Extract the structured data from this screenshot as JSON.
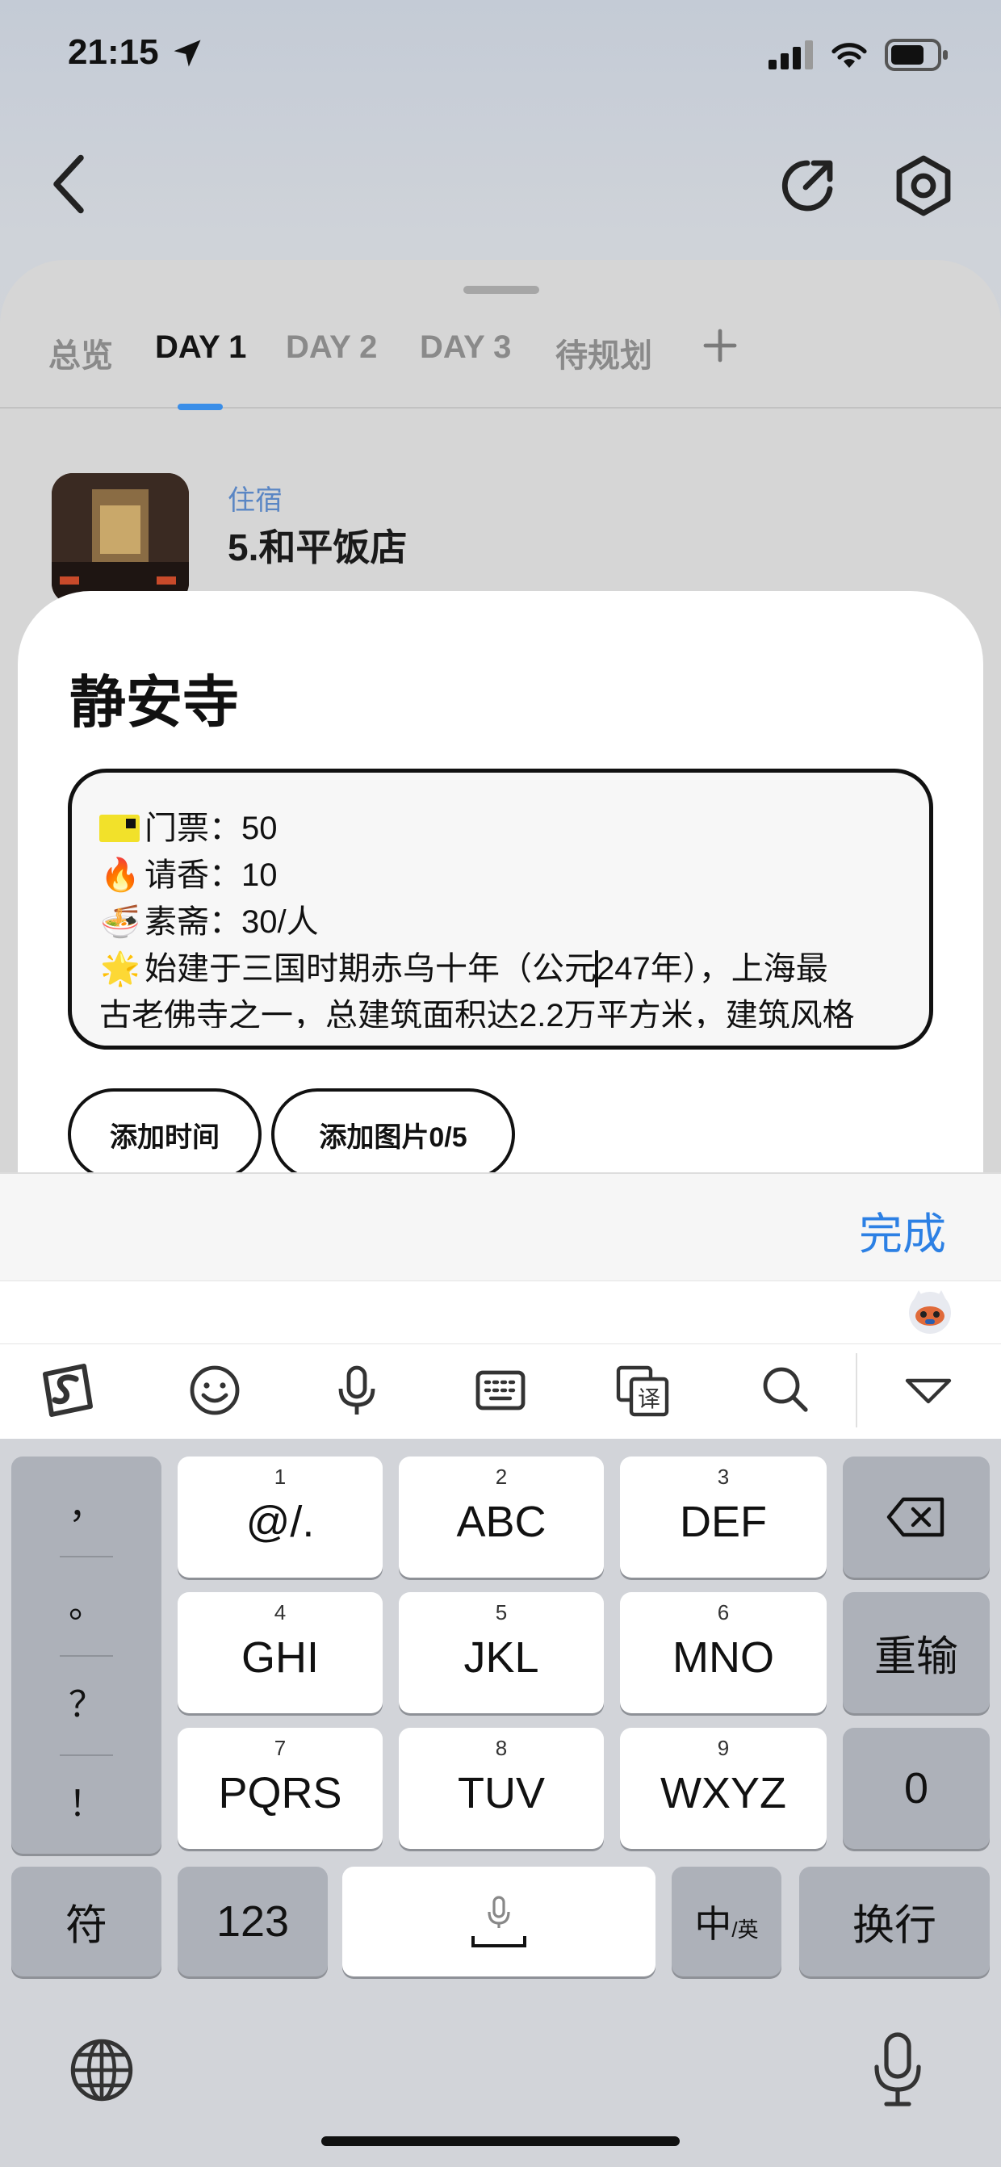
{
  "status_bar": {
    "time": "21:15"
  },
  "tabs": [
    {
      "label": "总览"
    },
    {
      "label": "DAY 1"
    },
    {
      "label": "DAY 2"
    },
    {
      "label": "DAY 3"
    },
    {
      "label": "待规划"
    }
  ],
  "hotel": {
    "type": "住宿",
    "name": "5.和平饭店"
  },
  "card": {
    "title": "静安寺",
    "notes": {
      "line1": "门票：50",
      "line2": "请香：10",
      "line3": "素斋：30/人",
      "line4_before": "始建于三国时期赤乌十年（公元",
      "line4_after": "247年），上海最",
      "line5": "古老佛寺之一，总建筑面积达2.2万平方米，建筑风格"
    },
    "add_time_label": "添加时间",
    "add_image_label": "添加图片0/5"
  },
  "toolbar": {
    "done_label": "完成"
  },
  "keyboard": {
    "punct": [
      "，",
      "。",
      "？",
      "！"
    ],
    "keys": [
      {
        "num": "1",
        "label": "@/."
      },
      {
        "num": "2",
        "label": "ABC"
      },
      {
        "num": "3",
        "label": "DEF"
      },
      {
        "num": "4",
        "label": "GHI"
      },
      {
        "num": "5",
        "label": "JKL"
      },
      {
        "num": "6",
        "label": "MNO"
      },
      {
        "num": "7",
        "label": "PQRS"
      },
      {
        "num": "8",
        "label": "TUV"
      },
      {
        "num": "9",
        "label": "WXYZ"
      }
    ],
    "retype_label": "重输",
    "zero_label": "0",
    "symbols_label": "符",
    "numbers_label": "123",
    "lang_main": "中",
    "lang_sub": "/英",
    "return_label": "换行"
  },
  "colors": {
    "accent": "#2c80e4",
    "tab_indicator": "#3a8ee8",
    "card_bg": "#ffffff",
    "keyboard_bg": "#d2d4d9"
  }
}
